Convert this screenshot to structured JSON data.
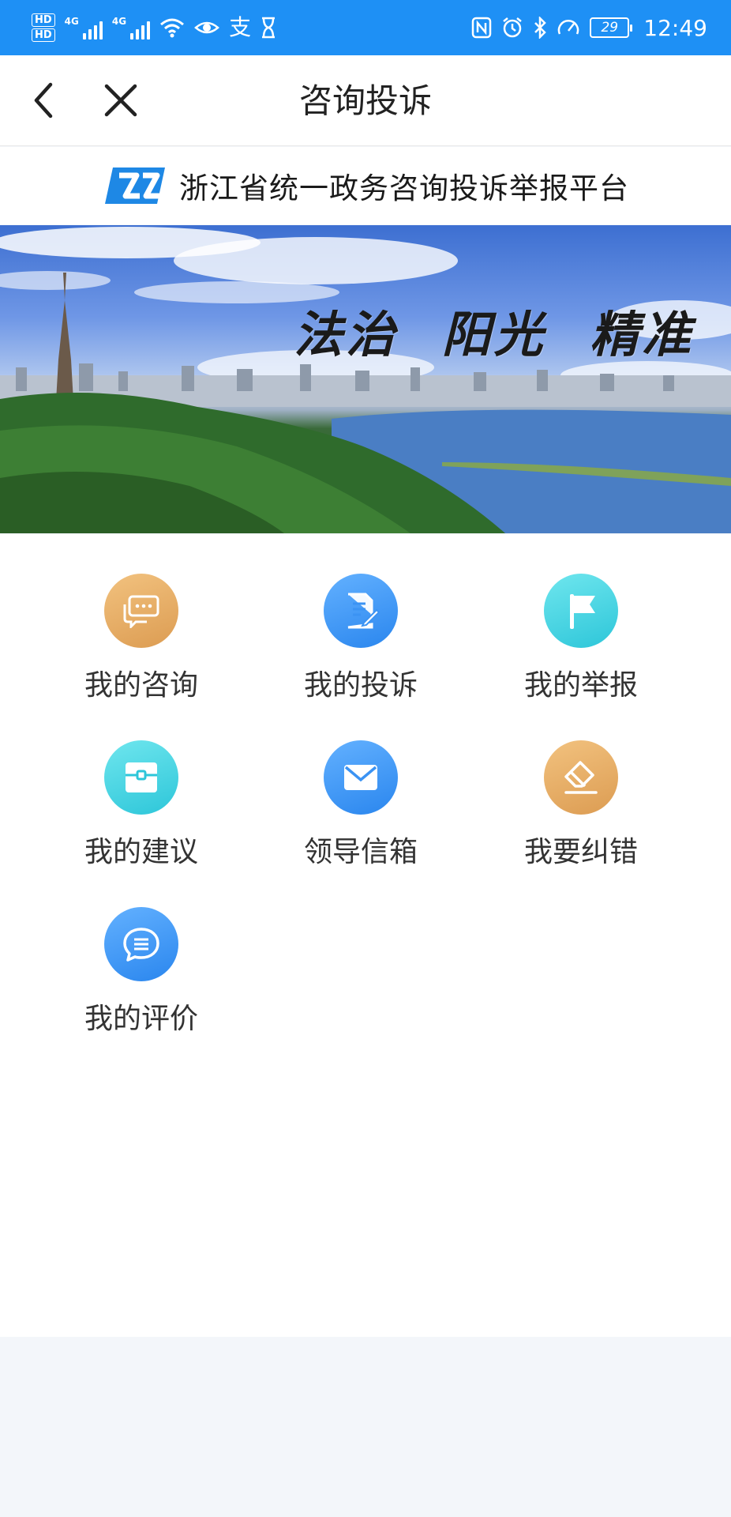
{
  "status_bar": {
    "hd1": "HD",
    "hd2": "HD",
    "sim1_label": "4G",
    "sim2_label": "4G",
    "battery": "29",
    "time": "12:49"
  },
  "nav": {
    "title": "咨询投诉"
  },
  "brand": {
    "text": "浙江省统一政务咨询投诉举报平台",
    "accent": "#1e88e5"
  },
  "banner": {
    "slogan": "法治 阳光 精准"
  },
  "menu": {
    "items": [
      {
        "label": "我的咨询",
        "icon": "chat-bubbles-icon",
        "color": "orange"
      },
      {
        "label": "我的投诉",
        "icon": "document-edit-icon",
        "color": "blue"
      },
      {
        "label": "我的举报",
        "icon": "flag-icon",
        "color": "cyan"
      },
      {
        "label": "我的建议",
        "icon": "suggestion-box-icon",
        "color": "cyan"
      },
      {
        "label": "领导信箱",
        "icon": "mail-icon",
        "color": "blue"
      },
      {
        "label": "我要纠错",
        "icon": "eraser-icon",
        "color": "orange"
      },
      {
        "label": "我的评价",
        "icon": "comment-icon",
        "color": "blue"
      }
    ]
  },
  "colors": {
    "status_bar": "#1e90f5",
    "orange": "#e5a862",
    "blue": "#3b93f3",
    "cyan": "#3fd3e2"
  }
}
